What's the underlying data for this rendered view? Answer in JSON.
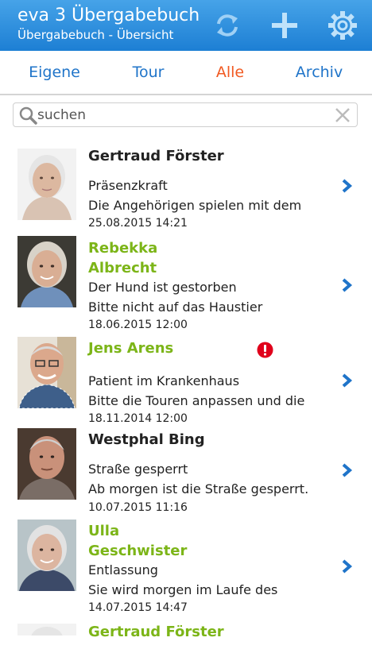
{
  "header": {
    "title": "eva 3 Übergabebuch",
    "subtitle": "Übergabebuch - Übersicht",
    "icons": [
      "sync-icon",
      "add-icon",
      "settings-gear-icon"
    ]
  },
  "tabs": [
    {
      "label": "Eigene",
      "active": false
    },
    {
      "label": "Tour",
      "active": false
    },
    {
      "label": "Alle",
      "active": true
    },
    {
      "label": "Archiv",
      "active": false
    }
  ],
  "colors": {
    "header": "#1d7fd4",
    "tab": "#1f74c9",
    "tab_active": "#f15a22",
    "name_green": "#7cb518",
    "chevron": "#1f74c9",
    "alert": "#e0001b"
  },
  "search": {
    "placeholder": "suchen",
    "value": ""
  },
  "entries": [
    {
      "name": "Gertraud Förster",
      "reason": "Präsenzkraft",
      "preview": "Die Angehörigen spielen mit dem",
      "date": "25.08.2015 14:21",
      "highlight": false,
      "alert": false
    },
    {
      "name": "Rebekka Albrecht",
      "reason": "Der Hund ist gestorben",
      "preview": "Bitte nicht auf das Haustier",
      "date": "18.06.2015 12:00",
      "highlight": true,
      "alert": false
    },
    {
      "name": "Jens Arens",
      "reason": "Patient im Krankenhaus",
      "preview": "Bitte die Touren anpassen und die",
      "date": "18.11.2014 12:00",
      "highlight": true,
      "alert": true
    },
    {
      "name": "Westphal Bing",
      "reason": "Straße gesperrt",
      "preview": "Ab morgen ist die Straße gesperrt.",
      "date": "10.07.2015 11:16",
      "highlight": false,
      "alert": false
    },
    {
      "name": "Ulla Geschwister",
      "reason": "Entlassung",
      "preview": "Sie wird morgen im Laufe des",
      "date": "14.07.2015 14:47",
      "highlight": true,
      "alert": false
    },
    {
      "name": "Gertraud Förster",
      "reason": "",
      "preview": "",
      "date": "",
      "highlight": true,
      "alert": false
    }
  ]
}
